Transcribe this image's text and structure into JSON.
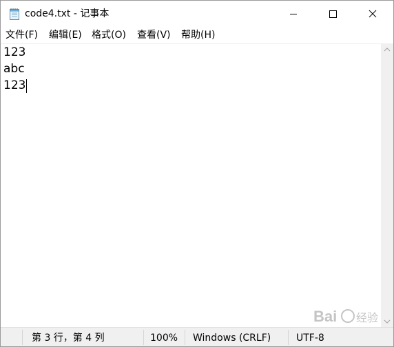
{
  "window": {
    "title": "code4.txt - 记事本",
    "icon": "notepad-icon"
  },
  "caption_buttons": {
    "minimize_icon": "minimize-icon",
    "maximize_icon": "maximize-icon",
    "close_icon": "close-icon"
  },
  "menu": {
    "items": [
      {
        "label": "文件(F)"
      },
      {
        "label": "编辑(E)"
      },
      {
        "label": "格式(O)"
      },
      {
        "label": "查看(V)"
      },
      {
        "label": "帮助(H)"
      }
    ]
  },
  "editor": {
    "lines": [
      "123",
      "abc",
      "123"
    ]
  },
  "status": {
    "position": "第 3 行，第 4 列",
    "zoom": "100%",
    "line_ending": "Windows (CRLF)",
    "encoding": "UTF-8"
  },
  "colors": {
    "text": "#000000",
    "statusbar_bg": "#f0f0f0",
    "scrollbar_bg": "#f0f0f0",
    "window_bg": "#ffffff"
  }
}
